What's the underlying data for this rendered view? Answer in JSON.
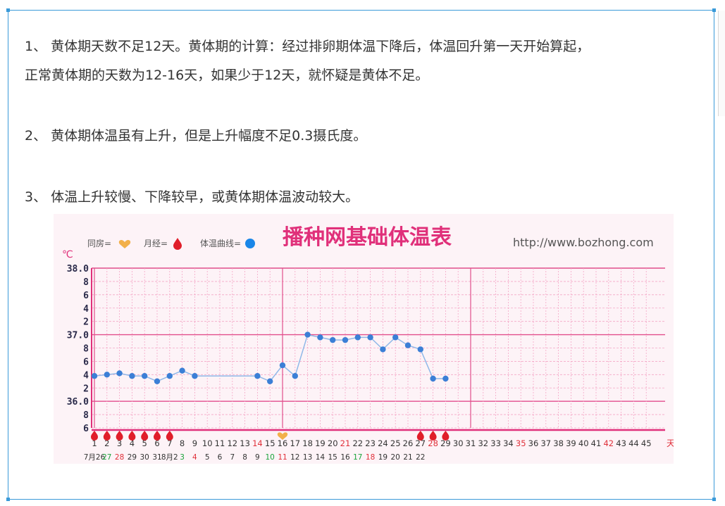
{
  "article": {
    "p1_line1": "1、 黄体期天数不足12天。黄体期的计算：经过排卵期体温下降后，体温回升第一天开始算起，",
    "p1_line2": "正常黄体期的天数为12-16天，如果少于12天，就怀疑是黄体不足。",
    "p2": "2、 黄体期体温虽有上升，但是上升幅度不足0.3摄氏度。",
    "p3": "3、 体温上升较慢、下降较早，或黄体期体温波动较大。"
  },
  "chart_data": {
    "type": "line",
    "title": "播种网基础体温表",
    "url": "http://www.bozhong.com",
    "legend": {
      "intercourse": "同房=",
      "period": "月经=",
      "curve": "体温曲线="
    },
    "yunit": "℃",
    "xunit": "天",
    "ylim": [
      35.6,
      38.0
    ],
    "yticks": [
      {
        "v": 38.0,
        "label": "38.0"
      },
      {
        "v": 37.8,
        "label": "8"
      },
      {
        "v": 37.6,
        "label": "6"
      },
      {
        "v": 37.4,
        "label": "4"
      },
      {
        "v": 37.2,
        "label": "2"
      },
      {
        "v": 37.0,
        "label": "37.0"
      },
      {
        "v": 36.8,
        "label": "8"
      },
      {
        "v": 36.6,
        "label": "6"
      },
      {
        "v": 36.4,
        "label": "4"
      },
      {
        "v": 36.2,
        "label": "2"
      },
      {
        "v": 36.0,
        "label": "36.0"
      },
      {
        "v": 35.8,
        "label": "8"
      },
      {
        "v": 35.6,
        "label": "6"
      }
    ],
    "days": [
      "1",
      "2",
      "3",
      "4",
      "5",
      "6",
      "7",
      "8",
      "9",
      "10",
      "11",
      "12",
      "13",
      "14",
      "15",
      "16",
      "17",
      "18",
      "19",
      "20",
      "21",
      "22",
      "23",
      "24",
      "25",
      "26",
      "27",
      "28",
      "29",
      "30",
      "31",
      "32",
      "33",
      "34",
      "35",
      "36",
      "37",
      "38",
      "39",
      "40",
      "41",
      "42",
      "43",
      "44",
      "45"
    ],
    "red_days": [
      14,
      21,
      28,
      35,
      42
    ],
    "dates": [
      "7月26",
      "27",
      "28",
      "29",
      "30",
      "31",
      "8月2",
      "3",
      "4",
      "5",
      "6",
      "7",
      "8",
      "9",
      "10",
      "11",
      "12",
      "13",
      "14",
      "15",
      "16",
      "17",
      "18",
      "19",
      "20",
      "21",
      "22"
    ],
    "date_colors": [
      "#333",
      "#1aa33a",
      "#e0303a",
      "#333",
      "#333",
      "#333",
      "#333",
      "#1aa33a",
      "#e0303a",
      "#333",
      "#333",
      "#333",
      "#333",
      "#333",
      "#1aa33a",
      "#e0303a",
      "#333",
      "#333",
      "#333",
      "#333",
      "#333",
      "#1aa33a",
      "#e0303a",
      "#333",
      "#333",
      "#333",
      "#333"
    ],
    "series": [
      {
        "x": [
          1,
          2,
          3,
          4,
          5,
          6,
          7,
          8,
          9,
          14,
          15,
          16,
          17,
          18,
          19,
          20,
          21,
          22,
          23,
          24,
          25,
          26,
          27,
          28,
          29
        ],
        "values": [
          36.38,
          36.4,
          36.42,
          36.38,
          36.38,
          36.3,
          36.38,
          36.46,
          36.38,
          36.38,
          36.3,
          36.54,
          36.38,
          37.0,
          36.96,
          36.92,
          36.92,
          36.96,
          36.96,
          36.78,
          36.96,
          36.84,
          36.78,
          36.34,
          36.34
        ]
      }
    ],
    "period_days": [
      1,
      2,
      3,
      4,
      5,
      6,
      7,
      27,
      28,
      29
    ],
    "intercourse_days": [
      16
    ],
    "colors": {
      "grid": "#f4a6c6",
      "grid_major": "#e24e8c",
      "axis": "#e0307a",
      "point": "#3b7fd6",
      "line": "#8fb8e8",
      "title": "#e0307a",
      "drop": "#e01e2a",
      "heart": "#f2b04a",
      "text_red": "#e0303a",
      "text_green": "#1aa33a"
    }
  }
}
